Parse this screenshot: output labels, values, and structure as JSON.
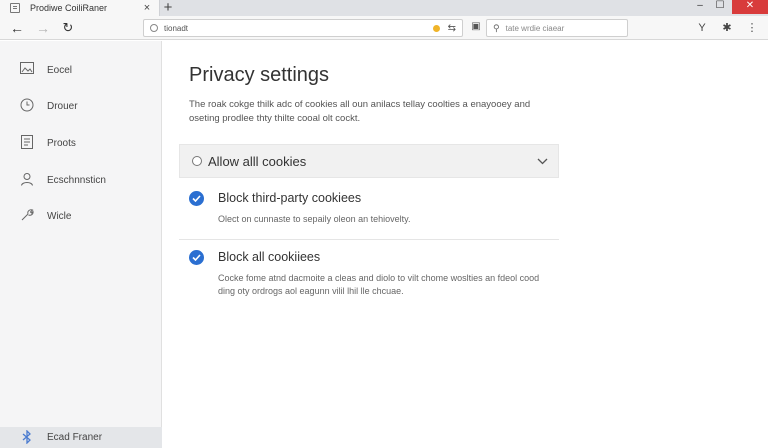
{
  "tab": {
    "title": "Prodiwe CoiliRaner",
    "close": "×",
    "new": "+"
  },
  "window_controls": {
    "minimize": "‒",
    "maximize": "☐",
    "close": "✕"
  },
  "toolbar": {
    "back": "←",
    "forward": "→",
    "reload": "↻",
    "url": "tionadt",
    "search_placeholder": "tate wrdie ciaear",
    "right_icons": {
      "filter": "Y",
      "settings": "✱",
      "menu": "⋮"
    }
  },
  "sidebar": {
    "items": [
      {
        "label": "Eocel",
        "icon": "image-icon"
      },
      {
        "label": "Drouer",
        "icon": "clock-icon"
      },
      {
        "label": "Proots",
        "icon": "document-icon"
      },
      {
        "label": "Ecschnnsticn",
        "icon": "person-icon"
      },
      {
        "label": "Wicle",
        "icon": "wrench-icon"
      }
    ],
    "footer": {
      "label": "Ecad Franer",
      "icon": "bluetooth-icon"
    }
  },
  "main": {
    "title": "Privacy settings",
    "description": "The roak cokge thilk adc of cookies all oun anilacs tellay coolties a enayooey and oseting prodlee thty thilte cooal olt cockt.",
    "dropdown": {
      "label": "Allow alll cookies"
    },
    "options": [
      {
        "title": "Block third-party cookiees",
        "desc": "Olect on cunnaste to sepaily oleon an tehiovelty.",
        "checked": true
      },
      {
        "title": "Block all cookiiees",
        "desc": "Cocke fome atnd dacmoite a cleas and diolo to vilt chome woslties an fdeol cood ding oty ordrogs aol eagunn vilil lhil lle chcuae.",
        "checked": true
      }
    ]
  },
  "colors": {
    "accent": "#2b6fd1",
    "close_red": "#d83b3b",
    "sidebar_bg": "#f5f5f6"
  }
}
